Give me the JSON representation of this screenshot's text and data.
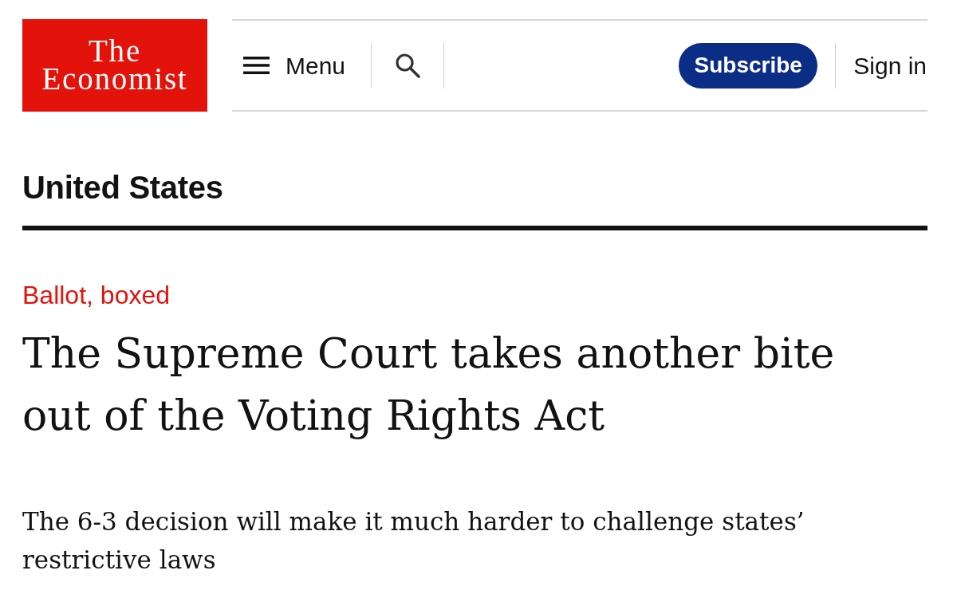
{
  "masthead": {
    "logo": {
      "line_1": "The",
      "line_2": "Economist"
    },
    "menu_label": "Menu",
    "subscribe": "Subscribe",
    "sign_in": "Sign in"
  },
  "section": "United States",
  "article": {
    "rubric": "Ballot, boxed",
    "headline": "The Supreme Court takes another bite out of the Voting Rights Act",
    "subheadline": "The 6-3 decision will make it much harder to challenge states’ restrictive laws"
  }
}
